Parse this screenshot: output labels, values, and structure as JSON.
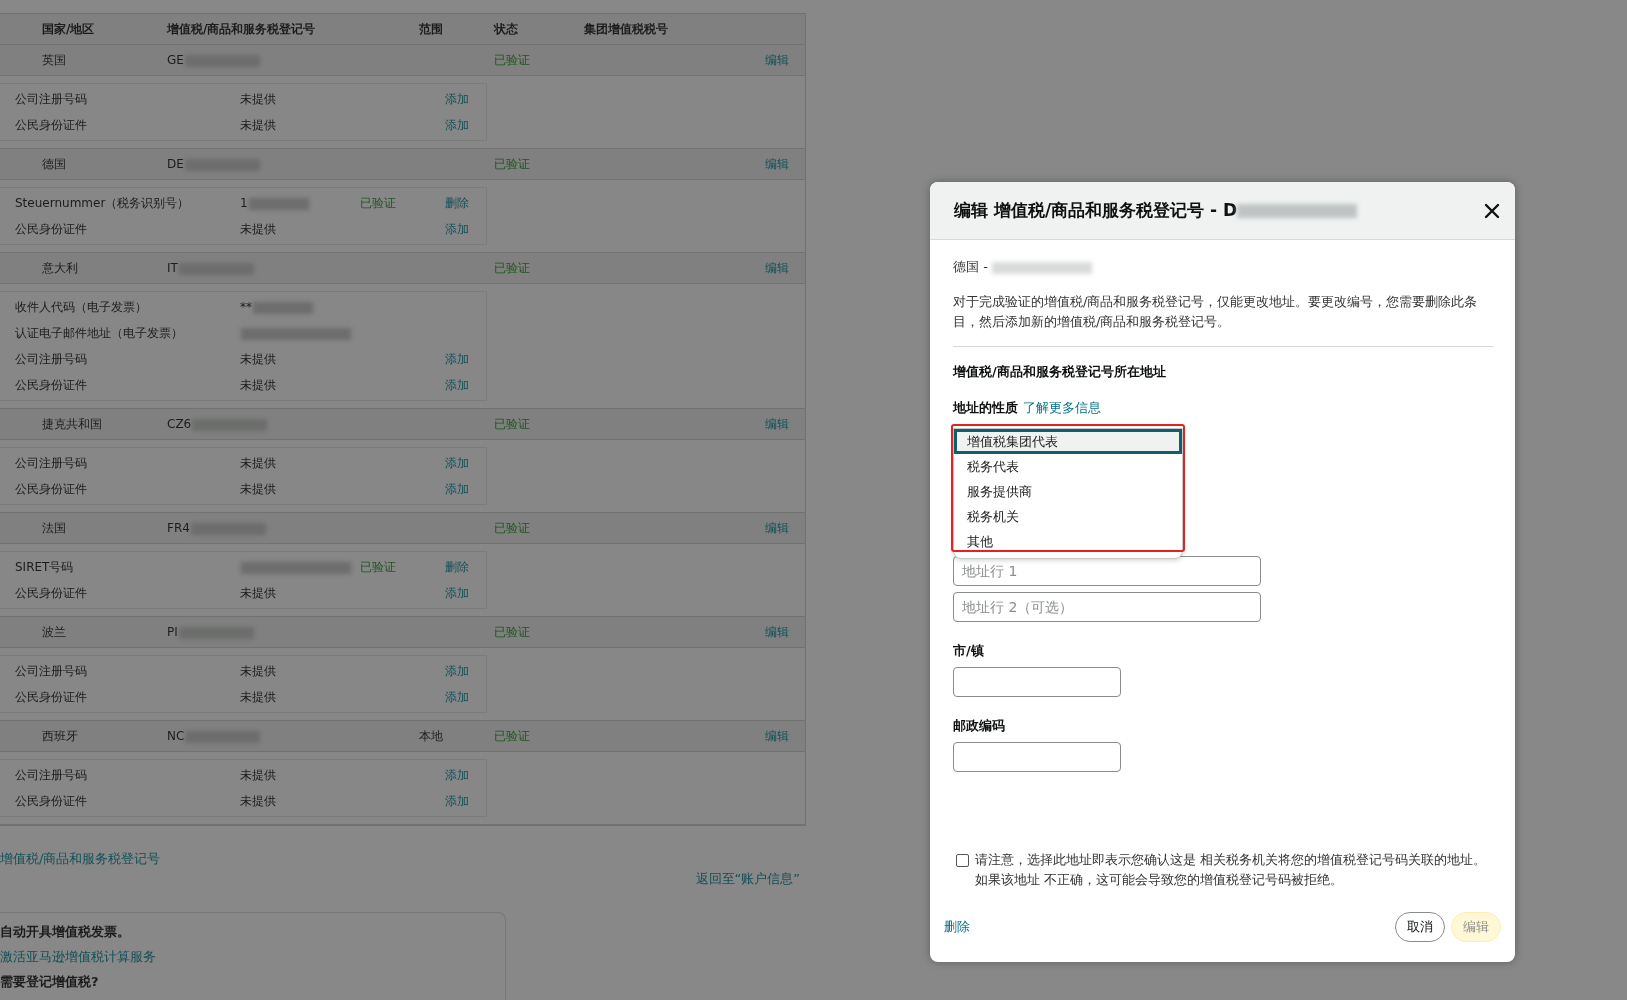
{
  "table": {
    "columns": [
      "国家/地区",
      "增值税/商品和服务税登记号",
      "范围",
      "状态",
      "集团增值税税号"
    ],
    "rows": [
      {
        "country": "英国",
        "number": "GE",
        "redacted": true,
        "status": "已验证",
        "action": "编辑",
        "details": [
          {
            "label": "公司注册号码",
            "value": "未提供",
            "action": "添加"
          },
          {
            "label": "公民身份证件",
            "value": "未提供",
            "action": "添加"
          }
        ]
      },
      {
        "country": "德国",
        "number": "DE",
        "redacted": true,
        "status": "已验证",
        "action": "编辑",
        "details": [
          {
            "label": "Steuernummer（税务识别号）",
            "value": "1",
            "redacted": true,
            "status": "已验证",
            "action": "删除"
          },
          {
            "label": "公民身份证件",
            "value": "未提供",
            "action": "添加"
          }
        ]
      },
      {
        "country": "意大利",
        "number": "IT",
        "redacted": true,
        "status": "已验证",
        "action": "编辑",
        "details": [
          {
            "label": "收件人代码（电子发票）",
            "value": "**",
            "redacted": true
          },
          {
            "label": "认证电子邮件地址（电子发票）",
            "redacted": true
          },
          {
            "label": "公司注册号码",
            "value": "未提供",
            "action": "添加"
          },
          {
            "label": "公民身份证件",
            "value": "未提供",
            "action": "添加"
          }
        ]
      },
      {
        "country": "捷克共和国",
        "number": "CZ6",
        "redacted": true,
        "status": "已验证",
        "action": "编辑",
        "details": [
          {
            "label": "公司注册号码",
            "value": "未提供",
            "action": "添加"
          },
          {
            "label": "公民身份证件",
            "value": "未提供",
            "action": "添加"
          }
        ]
      },
      {
        "country": "法国",
        "number": "FR4",
        "redacted": true,
        "status": "已验证",
        "action": "编辑",
        "details": [
          {
            "label": "SIRET号码",
            "redacted": true,
            "status": "已验证",
            "action": "删除"
          },
          {
            "label": "公民身份证件",
            "value": "未提供",
            "action": "添加"
          }
        ]
      },
      {
        "country": "波兰",
        "number": "PI",
        "redacted": true,
        "status": "已验证",
        "action": "编辑",
        "details": [
          {
            "label": "公司注册号码",
            "value": "未提供",
            "action": "添加"
          },
          {
            "label": "公民身份证件",
            "value": "未提供",
            "action": "添加"
          }
        ]
      },
      {
        "country": "西班牙",
        "number": "NC",
        "redacted": true,
        "scope": "本地",
        "status": "已验证",
        "action": "编辑",
        "details": [
          {
            "label": "公司注册号码",
            "value": "未提供",
            "action": "添加"
          },
          {
            "label": "公民身份证件",
            "value": "未提供",
            "action": "添加"
          }
        ]
      }
    ]
  },
  "add_link": "增值税/商品和服务税登记号",
  "back_link": "返回至“账户信息”",
  "info_box": {
    "heading": "自动开具增值税发票。",
    "link": "激活亚马逊增值税计算服务",
    "question": "需要登记增值税?"
  },
  "modal": {
    "title": "编辑 增值税/商品和服务税登记号 - D",
    "title_redacted": true,
    "subtitle": "德国 - ",
    "subtitle_redacted": true,
    "notice": "对于完成验证的增值税/商品和服务税登记号，仅能更改地址。要更改编号，您需要删除此条目，然后添加新的增值税/商品和服务税登记号。",
    "section_title": "增值税/商品和服务税登记号所在地址",
    "nature_label": "地址的性质",
    "learn_more": "了解更多信息",
    "options": [
      {
        "label": "增值税集团代表",
        "selected": true
      },
      {
        "label": "税务代表",
        "selected": false
      },
      {
        "label": "服务提供商",
        "selected": false
      },
      {
        "label": "税务机关",
        "selected": false
      },
      {
        "label": "其他",
        "selected": false
      }
    ],
    "address1": {
      "placeholder": "地址行 1"
    },
    "address2": {
      "placeholder": "地址行 2（可选）"
    },
    "city_label": "市/镇",
    "postcode_label": "邮政编码",
    "confirm": {
      "text": "请注意，选择此地址即表示您确认这是 相关税务机关将您的增值税登记号码关联的地址。如果该地址 不正确，这可能会导致您的增值税登记号码被拒绝。",
      "checked": false
    },
    "delete_link": "删除",
    "cancel": "取消",
    "submit": {
      "label": "编辑",
      "disabled": true
    }
  }
}
